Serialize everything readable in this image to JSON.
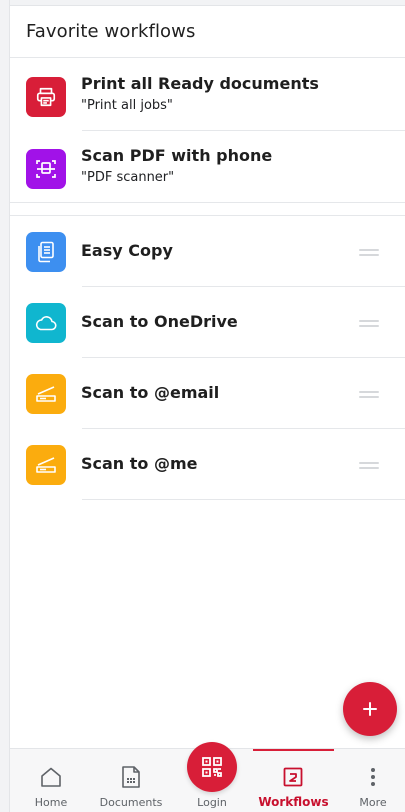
{
  "header": {
    "title": "Favorite workflows"
  },
  "favorites": [
    {
      "title": "Print all Ready documents",
      "subtitle": "\"Print all jobs\"",
      "icon": "printer-icon",
      "color": "#d81e38"
    },
    {
      "title": "Scan PDF with phone",
      "subtitle": "\"PDF scanner\"",
      "icon": "document-scan-icon",
      "color": "#a112e8"
    }
  ],
  "workflows": [
    {
      "title": "Easy Copy",
      "icon": "copy-document-icon",
      "color": "#3d8ff0"
    },
    {
      "title": "Scan to OneDrive",
      "icon": "cloud-icon",
      "color": "#10b6cf"
    },
    {
      "title": "Scan to @email",
      "icon": "scanner-icon",
      "color": "#fbac0e"
    },
    {
      "title": "Scan to @me",
      "icon": "scanner-icon",
      "color": "#fbac0e"
    }
  ],
  "fab": {
    "icon": "plus-icon"
  },
  "nav": {
    "home": "Home",
    "documents": "Documents",
    "login": "Login",
    "workflows": "Workflows",
    "more": "More",
    "active": "Workflows"
  },
  "colors": {
    "accent": "#d81e38",
    "active_text": "#c8102e"
  }
}
